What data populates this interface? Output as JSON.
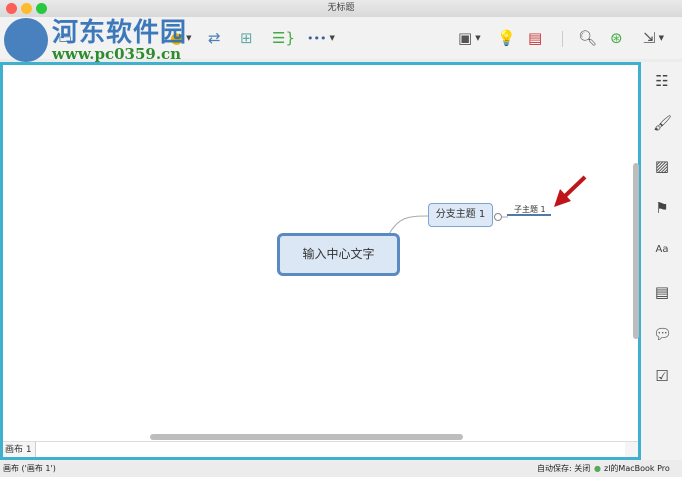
{
  "window": {
    "title": "无标题"
  },
  "watermark": {
    "name": "河东软件园",
    "url": "www.pc0359.cn"
  },
  "toolbar": {
    "more_label": "•••"
  },
  "mindmap": {
    "central": "输入中心文字",
    "branch": "分支主题 1",
    "subtopic": "子主题 1"
  },
  "sheet": {
    "tab": "画布 1"
  },
  "status": {
    "left": "画布 ('画布 1')",
    "autosave": "自动保存: 关闭",
    "device": "zl的MacBook Pro"
  },
  "colors": {
    "accent": "#3fb1cf",
    "arrow": "#c0141b"
  }
}
